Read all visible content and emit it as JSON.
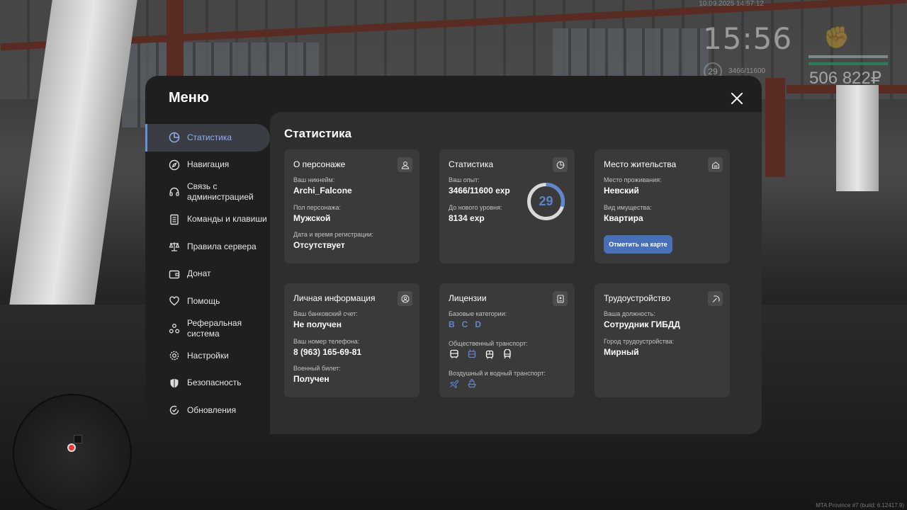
{
  "hud": {
    "datetime": "10.09.2025 14:57:12",
    "time": "15:56",
    "level": "29",
    "exp": "3466/11600",
    "money": "506 822₽",
    "build": "MTA Province #7 (build: 6.12417.9)"
  },
  "menu": {
    "title": "Меню",
    "nav": [
      {
        "label": "Статистика",
        "icon": "pie-chart-icon"
      },
      {
        "label": "Навигация",
        "icon": "compass-icon"
      },
      {
        "label": "Связь с администрацией",
        "icon": "headset-icon"
      },
      {
        "label": "Команды и клавиши",
        "icon": "document-icon"
      },
      {
        "label": "Правила сервера",
        "icon": "scales-icon"
      },
      {
        "label": "Донат",
        "icon": "wallet-icon"
      },
      {
        "label": "Помощь",
        "icon": "heart-hand-icon"
      },
      {
        "label": "Реферальная система",
        "icon": "referral-icon"
      },
      {
        "label": "Настройки",
        "icon": "gear-icon"
      },
      {
        "label": "Безопасность",
        "icon": "shield-icon"
      },
      {
        "label": "Обновления",
        "icon": "refresh-check-icon"
      }
    ]
  },
  "content": {
    "title": "Статистика",
    "character": {
      "title": "О персонаже",
      "nickname_label": "Ваш никнейм:",
      "nickname": "Archi_Falcone",
      "gender_label": "Пол персонажа:",
      "gender": "Мужской",
      "reg_label": "Дата и время регистрации:",
      "reg": "Отсутствует"
    },
    "stats": {
      "title": "Статистика",
      "exp_label": "Ваш опыт:",
      "exp": "3466/11600 exp",
      "next_label": "До нового уровня:",
      "next": "8134 exp",
      "level": "29",
      "progress": 0.299
    },
    "residence": {
      "title": "Место жительства",
      "place_label": "Место проживания:",
      "place": "Невский",
      "property_label": "Вид имущества:",
      "property": "Квартира",
      "button": "Отметить на карте"
    },
    "personal": {
      "title": "Личная информация",
      "bank_label": "Ваш банковский счет:",
      "bank": "Не получен",
      "phone_label": "Ваш номер телефона:",
      "phone": "8 (963) 165-69-81",
      "military_label": "Военный билет:",
      "military": "Получен"
    },
    "licenses": {
      "title": "Лицензии",
      "base_label": "Базовые категории:",
      "categories": [
        "B",
        "C",
        "D"
      ],
      "public_label": "Общественный транспорт:",
      "air_label": "Воздушный и водный транспорт:"
    },
    "job": {
      "title": "Трудоустройство",
      "position_label": "Ваша должность:",
      "position": "Сотрудник ГИБДД",
      "city_label": "Город трудоустройства:",
      "city": "Мирный"
    }
  },
  "colors": {
    "accent": "#5f86cc",
    "button": "#4870b8",
    "card": "#3a3a3a",
    "panel": "#2e2e2e",
    "window": "#1f1f1f"
  }
}
